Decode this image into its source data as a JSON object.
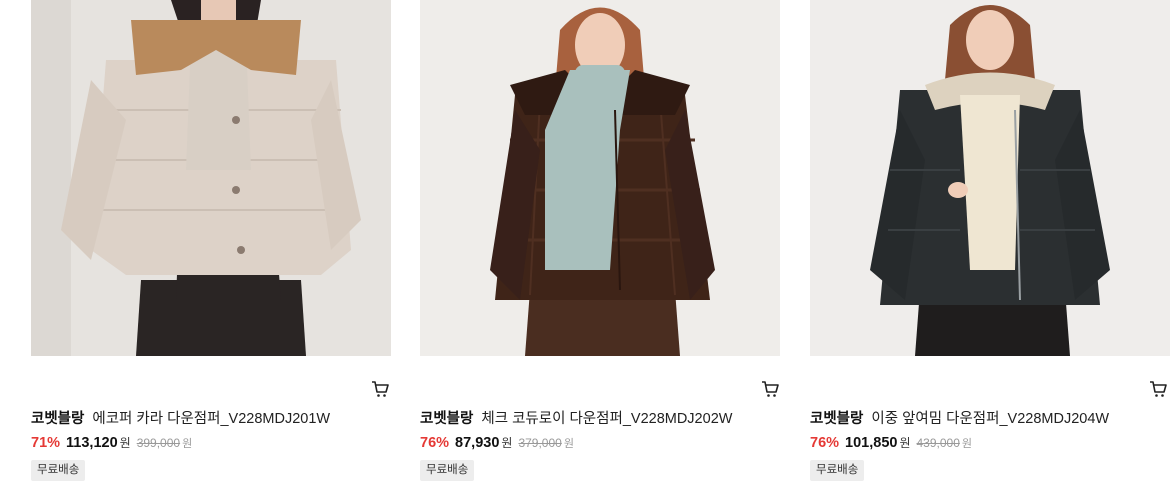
{
  "products": [
    {
      "brand": "코벳블랑",
      "name": "에코퍼 카라 다운점퍼_V228MDJ201W",
      "discount_rate": "71%",
      "price": "113,120",
      "price_unit": "원",
      "original_price": "399,000",
      "original_unit": "원",
      "badge": "무료배송",
      "colors": {
        "background": "#e6e3df",
        "jacket": "#ddd2c8",
        "collar": "#b98a5c",
        "pants": "#2a2524"
      }
    },
    {
      "brand": "코벳블랑",
      "name": "체크 코듀로이 다운점퍼_V228MDJ202W",
      "discount_rate": "76%",
      "price": "87,930",
      "price_unit": "원",
      "original_price": "379,000",
      "original_unit": "원",
      "badge": "무료배송",
      "colors": {
        "background": "#efedea",
        "jacket": "#3f2418",
        "sweater": "#a9c0bd",
        "pants": "#4a2d20"
      }
    },
    {
      "brand": "코벳블랑",
      "name": "이중 앞여밈 다운점퍼_V228MDJ204W",
      "discount_rate": "76%",
      "price": "101,850",
      "price_unit": "원",
      "original_price": "439,000",
      "original_unit": "원",
      "badge": "무료배송",
      "colors": {
        "background": "#efedeb",
        "jacket": "#2b2f31",
        "sweater": "#efe6d2",
        "pants": "#1f1d1d"
      }
    }
  ],
  "icons": {
    "cart": "cart-icon"
  },
  "accent": {
    "discount": "#e53935",
    "badge_bg": "#ededed"
  }
}
